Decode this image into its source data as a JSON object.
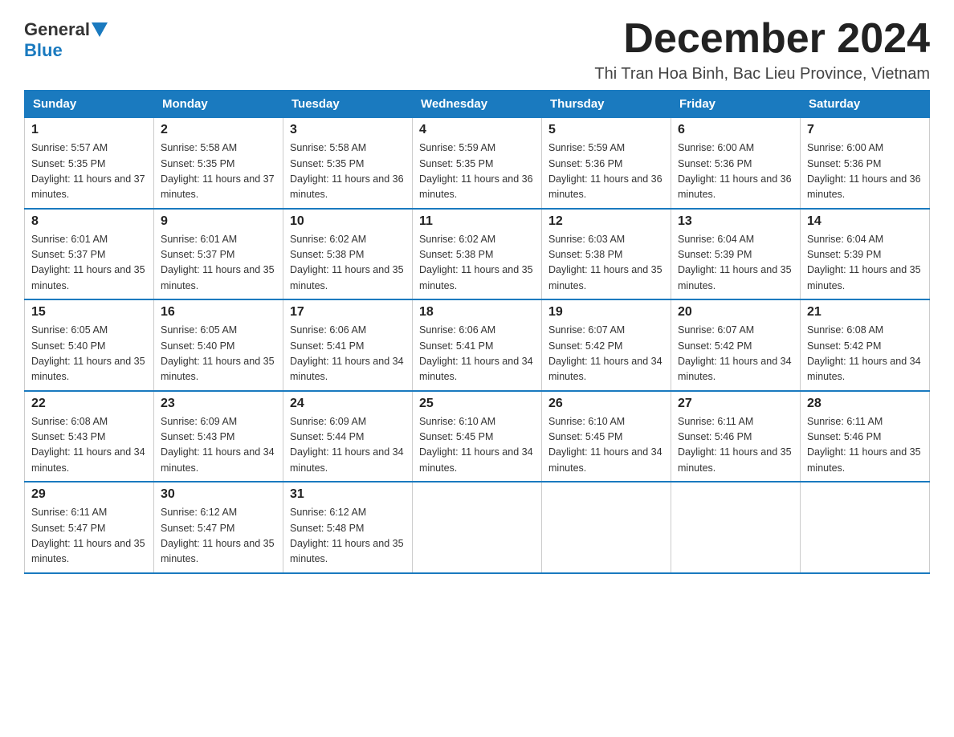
{
  "logo": {
    "general": "General",
    "blue": "Blue"
  },
  "title": "December 2024",
  "subtitle": "Thi Tran Hoa Binh, Bac Lieu Province, Vietnam",
  "days_of_week": [
    "Sunday",
    "Monday",
    "Tuesday",
    "Wednesday",
    "Thursday",
    "Friday",
    "Saturday"
  ],
  "weeks": [
    [
      {
        "day": "1",
        "sunrise": "5:57 AM",
        "sunset": "5:35 PM",
        "daylight": "11 hours and 37 minutes."
      },
      {
        "day": "2",
        "sunrise": "5:58 AM",
        "sunset": "5:35 PM",
        "daylight": "11 hours and 37 minutes."
      },
      {
        "day": "3",
        "sunrise": "5:58 AM",
        "sunset": "5:35 PM",
        "daylight": "11 hours and 36 minutes."
      },
      {
        "day": "4",
        "sunrise": "5:59 AM",
        "sunset": "5:35 PM",
        "daylight": "11 hours and 36 minutes."
      },
      {
        "day": "5",
        "sunrise": "5:59 AM",
        "sunset": "5:36 PM",
        "daylight": "11 hours and 36 minutes."
      },
      {
        "day": "6",
        "sunrise": "6:00 AM",
        "sunset": "5:36 PM",
        "daylight": "11 hours and 36 minutes."
      },
      {
        "day": "7",
        "sunrise": "6:00 AM",
        "sunset": "5:36 PM",
        "daylight": "11 hours and 36 minutes."
      }
    ],
    [
      {
        "day": "8",
        "sunrise": "6:01 AM",
        "sunset": "5:37 PM",
        "daylight": "11 hours and 35 minutes."
      },
      {
        "day": "9",
        "sunrise": "6:01 AM",
        "sunset": "5:37 PM",
        "daylight": "11 hours and 35 minutes."
      },
      {
        "day": "10",
        "sunrise": "6:02 AM",
        "sunset": "5:38 PM",
        "daylight": "11 hours and 35 minutes."
      },
      {
        "day": "11",
        "sunrise": "6:02 AM",
        "sunset": "5:38 PM",
        "daylight": "11 hours and 35 minutes."
      },
      {
        "day": "12",
        "sunrise": "6:03 AM",
        "sunset": "5:38 PM",
        "daylight": "11 hours and 35 minutes."
      },
      {
        "day": "13",
        "sunrise": "6:04 AM",
        "sunset": "5:39 PM",
        "daylight": "11 hours and 35 minutes."
      },
      {
        "day": "14",
        "sunrise": "6:04 AM",
        "sunset": "5:39 PM",
        "daylight": "11 hours and 35 minutes."
      }
    ],
    [
      {
        "day": "15",
        "sunrise": "6:05 AM",
        "sunset": "5:40 PM",
        "daylight": "11 hours and 35 minutes."
      },
      {
        "day": "16",
        "sunrise": "6:05 AM",
        "sunset": "5:40 PM",
        "daylight": "11 hours and 35 minutes."
      },
      {
        "day": "17",
        "sunrise": "6:06 AM",
        "sunset": "5:41 PM",
        "daylight": "11 hours and 34 minutes."
      },
      {
        "day": "18",
        "sunrise": "6:06 AM",
        "sunset": "5:41 PM",
        "daylight": "11 hours and 34 minutes."
      },
      {
        "day": "19",
        "sunrise": "6:07 AM",
        "sunset": "5:42 PM",
        "daylight": "11 hours and 34 minutes."
      },
      {
        "day": "20",
        "sunrise": "6:07 AM",
        "sunset": "5:42 PM",
        "daylight": "11 hours and 34 minutes."
      },
      {
        "day": "21",
        "sunrise": "6:08 AM",
        "sunset": "5:42 PM",
        "daylight": "11 hours and 34 minutes."
      }
    ],
    [
      {
        "day": "22",
        "sunrise": "6:08 AM",
        "sunset": "5:43 PM",
        "daylight": "11 hours and 34 minutes."
      },
      {
        "day": "23",
        "sunrise": "6:09 AM",
        "sunset": "5:43 PM",
        "daylight": "11 hours and 34 minutes."
      },
      {
        "day": "24",
        "sunrise": "6:09 AM",
        "sunset": "5:44 PM",
        "daylight": "11 hours and 34 minutes."
      },
      {
        "day": "25",
        "sunrise": "6:10 AM",
        "sunset": "5:45 PM",
        "daylight": "11 hours and 34 minutes."
      },
      {
        "day": "26",
        "sunrise": "6:10 AM",
        "sunset": "5:45 PM",
        "daylight": "11 hours and 34 minutes."
      },
      {
        "day": "27",
        "sunrise": "6:11 AM",
        "sunset": "5:46 PM",
        "daylight": "11 hours and 35 minutes."
      },
      {
        "day": "28",
        "sunrise": "6:11 AM",
        "sunset": "5:46 PM",
        "daylight": "11 hours and 35 minutes."
      }
    ],
    [
      {
        "day": "29",
        "sunrise": "6:11 AM",
        "sunset": "5:47 PM",
        "daylight": "11 hours and 35 minutes."
      },
      {
        "day": "30",
        "sunrise": "6:12 AM",
        "sunset": "5:47 PM",
        "daylight": "11 hours and 35 minutes."
      },
      {
        "day": "31",
        "sunrise": "6:12 AM",
        "sunset": "5:48 PM",
        "daylight": "11 hours and 35 minutes."
      },
      null,
      null,
      null,
      null
    ]
  ]
}
